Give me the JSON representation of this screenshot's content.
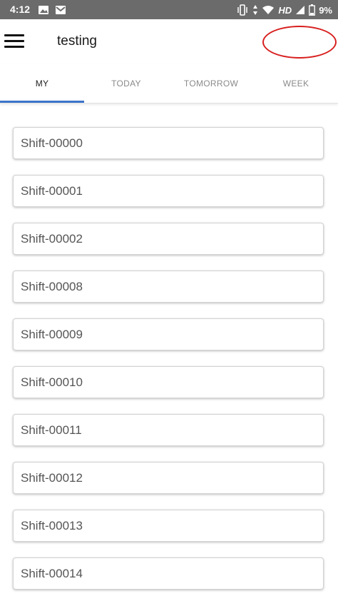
{
  "status_bar": {
    "time": "4:12",
    "hd": "HD",
    "battery": "9%"
  },
  "app_bar": {
    "title": "testing"
  },
  "tabs": [
    {
      "label": "MY",
      "active": true
    },
    {
      "label": "TODAY",
      "active": false
    },
    {
      "label": "TOMORROW",
      "active": false
    },
    {
      "label": "WEEK",
      "active": false
    }
  ],
  "shifts": [
    "Shift-00000",
    "Shift-00001",
    "Shift-00002",
    "Shift-00008",
    "Shift-00009",
    "Shift-00010",
    "Shift-00011",
    "Shift-00012",
    "Shift-00013",
    "Shift-00014"
  ],
  "colors": {
    "accent": "#3b74c9",
    "annotation": "#d81e1e",
    "status_bar": "#6b6b6b"
  }
}
